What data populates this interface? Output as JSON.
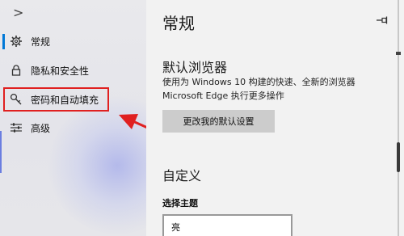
{
  "sidebar": {
    "expand": ">",
    "items": [
      {
        "label": "常规",
        "icon": "gear-icon"
      },
      {
        "label": "隐私和安全性",
        "icon": "lock-icon"
      },
      {
        "label": "密码和自动填充",
        "icon": "key-icon"
      },
      {
        "label": "高级",
        "icon": "sliders-icon"
      }
    ]
  },
  "main": {
    "title": "常规",
    "default_browser": {
      "heading": "默认浏览器",
      "description": "使用为 Windows 10 构建的快速、全新的浏览器 Microsoft Edge 执行更多操作",
      "button_label": "更改我的默认设置"
    },
    "customize": {
      "heading": "自定义",
      "theme_label": "选择主题",
      "theme_value": "亮"
    }
  },
  "colors": {
    "accent": "#0078d7",
    "annotation": "#e02020"
  }
}
